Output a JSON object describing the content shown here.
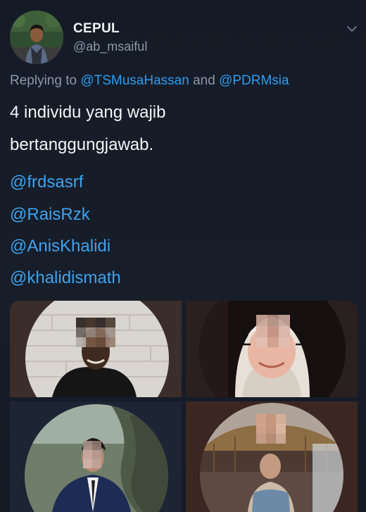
{
  "tweet": {
    "author": {
      "display_name": "CEPUL",
      "handle": "@ab_msaiful"
    },
    "reply": {
      "prefix": "Replying to ",
      "mention_1": "@TSMusaHassan",
      "joiner": " and ",
      "mention_2": "@PDRMsia"
    },
    "text_lines": [
      "4 individu yang wajib",
      "bertanggungjawab."
    ],
    "mentions": [
      "@frdsasrf",
      "@RaisRzk",
      "@AnisKhalidi",
      "@khalidismath"
    ]
  },
  "colors": {
    "background": "#151c27",
    "link": "#2a9df4",
    "secondary_text": "#8899a6",
    "primary_text": "#f3f4f5"
  },
  "icons": {
    "caret": "chevron-down-icon"
  }
}
